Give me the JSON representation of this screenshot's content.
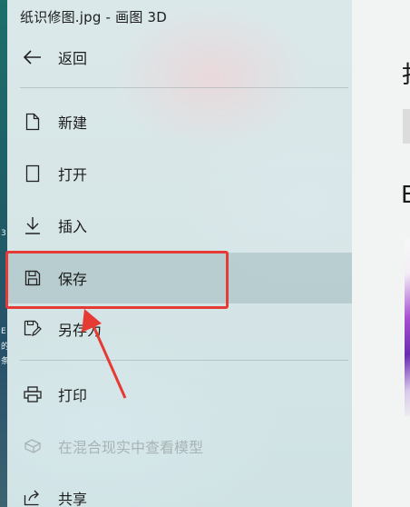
{
  "window": {
    "title": "纸识修图.jpg - 画图 3D"
  },
  "menu": {
    "back": {
      "label": "返回",
      "icon": "back-arrow-icon"
    },
    "items": [
      {
        "label": "新建",
        "icon": "new-file-icon"
      },
      {
        "label": "打开",
        "icon": "open-file-icon"
      },
      {
        "label": "插入",
        "icon": "insert-icon"
      },
      {
        "label": "保存",
        "icon": "save-icon"
      },
      {
        "label": "另存为",
        "icon": "save-as-icon"
      },
      {
        "label": "打印",
        "icon": "print-icon"
      },
      {
        "label": "在混合现实中查看模型",
        "icon": "mixed-reality-icon"
      },
      {
        "label": "共享",
        "icon": "share-icon"
      }
    ]
  },
  "left_strip": {
    "glyphs": [
      "3",
      "E",
      "的",
      "条"
    ]
  },
  "annotation": {
    "highlight_color": "#e53b34",
    "target": "保存"
  },
  "right_panel": {
    "heading_fragment": "扌",
    "section_fragment": "E"
  },
  "colors": {
    "panel_bg": "#d7e6e7",
    "selected_bg": "#a9bfc3",
    "accent_red": "#e53b34"
  }
}
